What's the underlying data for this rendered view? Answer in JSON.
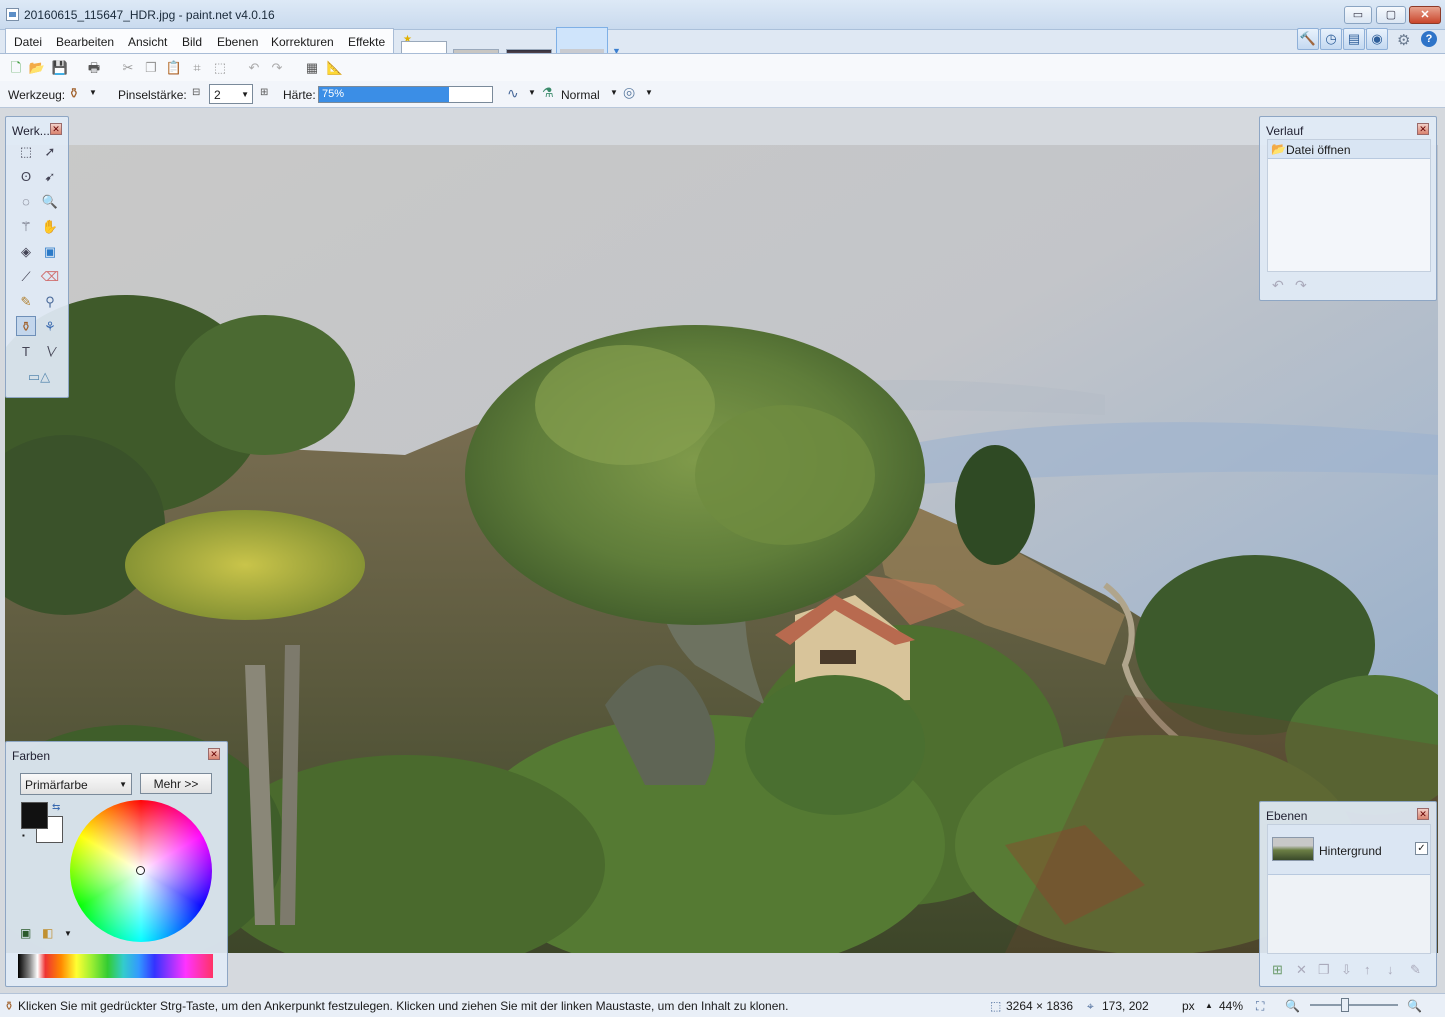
{
  "window": {
    "title": "20160615_115647_HDR.jpg - paint.net v4.0.16",
    "minimize": "▭",
    "maximize": "▢",
    "close": "✕"
  },
  "menu": [
    "Datei",
    "Bearbeiten",
    "Ansicht",
    "Bild",
    "Ebenen",
    "Korrekturen",
    "Effekte"
  ],
  "toolbar_options": {
    "tool_label": "Werkzeug:",
    "brush_label": "Pinselstärke:",
    "brush_value": "2",
    "hardness_label": "Härte:",
    "hardness_value": "75%",
    "hardness_fraction": 0.75,
    "blend_mode": "Normal"
  },
  "panels": {
    "tools": {
      "title": "Werk..."
    },
    "history": {
      "title": "Verlauf",
      "items": [
        "Datei öffnen"
      ]
    },
    "layers": {
      "title": "Ebenen",
      "items": [
        "Hintergrund"
      ]
    },
    "colors": {
      "title": "Farben",
      "mode": "Primärfarbe",
      "more": "Mehr >>"
    }
  },
  "status": {
    "hint": "Klicken Sie mit gedrückter Strg-Taste, um den Ankerpunkt festzulegen. Klicken und ziehen Sie mit der linken Maustaste, um den Inhalt zu klonen.",
    "size": "3264 × 1836",
    "position": "173, 202",
    "unit": "px",
    "zoom": "44%"
  },
  "colors": {
    "accent": "#3b8ee6",
    "primary": "#111111",
    "secondary": "#ffffff"
  }
}
